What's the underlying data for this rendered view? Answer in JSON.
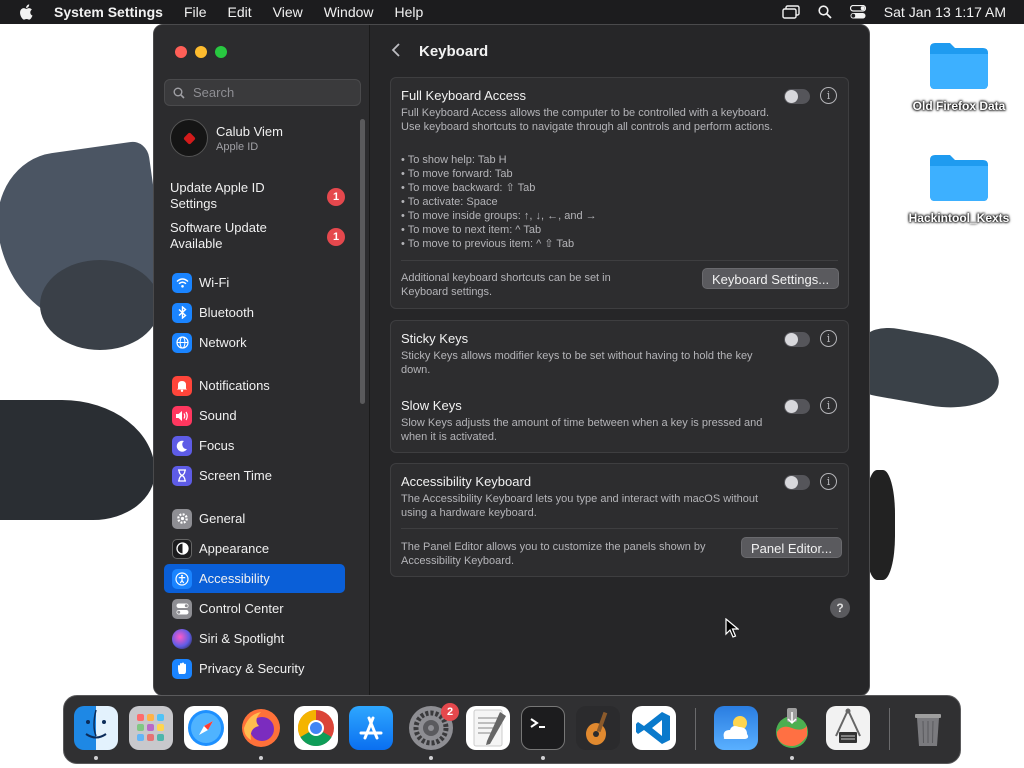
{
  "menubar": {
    "app_name": "System Settings",
    "menus": [
      "File",
      "Edit",
      "View",
      "Window",
      "Help"
    ],
    "clock": "Sat Jan 13  1:17 AM"
  },
  "desktop": {
    "icons": [
      {
        "label": "Old Firefox Data"
      },
      {
        "label": "Hackintool_Kexts"
      }
    ]
  },
  "sidebar": {
    "search_placeholder": "Search",
    "profile": {
      "name": "Calub Viem",
      "subtitle": "Apple ID"
    },
    "notices": [
      {
        "label": "Update Apple ID Settings",
        "badge": "1"
      },
      {
        "label": "Software Update Available",
        "badge": "1"
      }
    ],
    "items": [
      {
        "label": "Wi-Fi",
        "icon": "wifi-icon",
        "color": "#1a84ff"
      },
      {
        "label": "Bluetooth",
        "icon": "bluetooth-icon",
        "color": "#1a84ff"
      },
      {
        "label": "Network",
        "icon": "globe-icon",
        "color": "#1a84ff"
      },
      {
        "label": "Notifications",
        "icon": "bell-icon",
        "color": "#ff453a"
      },
      {
        "label": "Sound",
        "icon": "speaker-icon",
        "color": "#ff375f"
      },
      {
        "label": "Focus",
        "icon": "moon-icon",
        "color": "#5e5ce6"
      },
      {
        "label": "Screen Time",
        "icon": "hourglass-icon",
        "color": "#5e5ce6"
      },
      {
        "label": "General",
        "icon": "gear-icon",
        "color": "#8e8e93"
      },
      {
        "label": "Appearance",
        "icon": "appearance-icon",
        "color": "#1c1c1e"
      },
      {
        "label": "Accessibility",
        "icon": "accessibility-icon",
        "color": "#1a84ff"
      },
      {
        "label": "Control Center",
        "icon": "control-center-icon",
        "color": "#8e8e93"
      },
      {
        "label": "Siri & Spotlight",
        "icon": "siri-icon",
        "color": "#bf5af2"
      },
      {
        "label": "Privacy & Security",
        "icon": "hand-icon",
        "color": "#1a84ff"
      }
    ],
    "active_item": "Accessibility"
  },
  "content": {
    "title": "Keyboard",
    "full_keyboard_access": {
      "title": "Full Keyboard Access",
      "description": "Full Keyboard Access allows the computer to be controlled with a keyboard. Use keyboard shortcuts to navigate through all controls and perform actions.",
      "tips": [
        "• To show help: Tab H",
        "• To move forward: Tab",
        "• To move backward: ⇧ Tab",
        "• To activate: Space",
        "• To move inside groups: ↑, ↓, ←, and →",
        "• To move to next item: ^ Tab",
        "• To move to previous item: ^ ⇧ Tab"
      ],
      "enabled": false,
      "footer_text": "Additional keyboard shortcuts can be set in Keyboard settings.",
      "button": "Keyboard Settings..."
    },
    "sticky_keys": {
      "title": "Sticky Keys",
      "description": "Sticky Keys allows modifier keys to be set without having to hold the key down.",
      "enabled": false
    },
    "slow_keys": {
      "title": "Slow Keys",
      "description": "Slow Keys adjusts the amount of time between when a key is pressed and when it is activated.",
      "enabled": false
    },
    "accessibility_keyboard": {
      "title": "Accessibility Keyboard",
      "description": "The Accessibility Keyboard lets you type and interact with macOS without using a hardware keyboard.",
      "enabled": false,
      "footer_text": "The Panel Editor allows you to customize the panels shown by Accessibility Keyboard.",
      "button": "Panel Editor..."
    },
    "help_label": "?"
  },
  "dock": {
    "apps": [
      {
        "name": "Finder",
        "icon": "finder-icon"
      },
      {
        "name": "Launchpad",
        "icon": "launchpad-icon"
      },
      {
        "name": "Safari",
        "icon": "safari-icon"
      },
      {
        "name": "Firefox",
        "icon": "firefox-icon"
      },
      {
        "name": "Chrome",
        "icon": "chrome-icon"
      },
      {
        "name": "App Store",
        "icon": "app-store-icon"
      },
      {
        "name": "System Settings",
        "icon": "system-settings-icon",
        "badge": "2"
      },
      {
        "name": "TextEdit",
        "icon": "textedit-icon"
      },
      {
        "name": "Terminal",
        "icon": "terminal-icon"
      },
      {
        "name": "GarageBand",
        "icon": "garageband-icon"
      },
      {
        "name": "Visual Studio Code",
        "icon": "vscode-icon"
      },
      {
        "name": "Weather",
        "icon": "weather-icon"
      },
      {
        "name": "macOS Installer",
        "icon": "installer-icon"
      },
      {
        "name": "System Information",
        "icon": "system-info-icon"
      },
      {
        "name": "Trash",
        "icon": "trash-icon"
      }
    ]
  }
}
